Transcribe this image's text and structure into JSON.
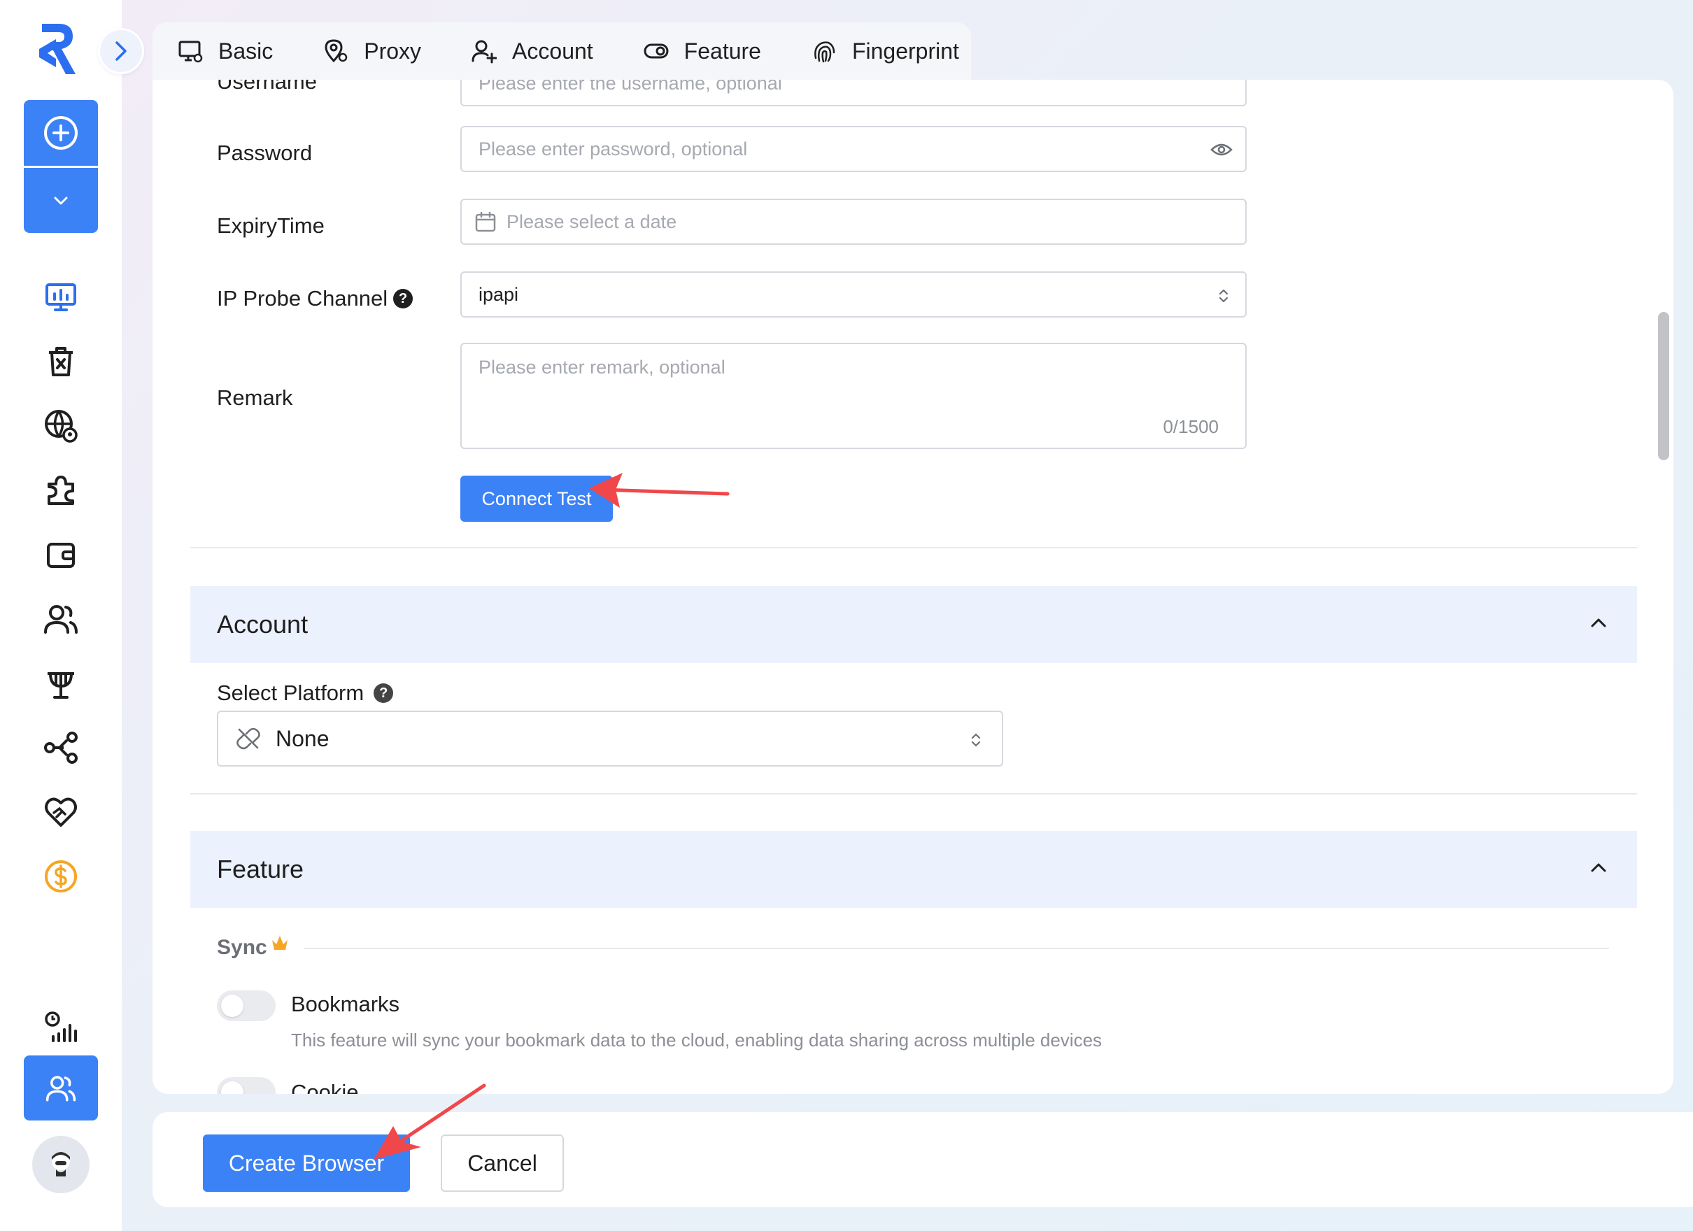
{
  "tabs": [
    {
      "label": "Basic",
      "icon": "monitor-settings-icon"
    },
    {
      "label": "Proxy",
      "icon": "location-settings-icon"
    },
    {
      "label": "Account",
      "icon": "user-add-icon"
    },
    {
      "label": "Feature",
      "icon": "toggle-icon"
    },
    {
      "label": "Fingerprint",
      "icon": "fingerprint-icon"
    }
  ],
  "form": {
    "username_label": "Username",
    "username_placeholder": "Please enter the username, optional",
    "password_label": "Password",
    "password_placeholder": "Please enter password, optional",
    "expiry_label": "ExpiryTime",
    "expiry_placeholder": "Please select a date",
    "ip_probe_label": "IP Probe Channel",
    "ip_probe_value": "ipapi",
    "remark_label": "Remark",
    "remark_placeholder": "Please enter remark, optional",
    "remark_count": "0/1500",
    "connect_test_label": "Connect Test"
  },
  "account_section": {
    "title": "Account",
    "select_platform_label": "Select Platform",
    "platform_value": "None"
  },
  "feature_section": {
    "title": "Feature",
    "sync_label": "Sync",
    "bookmarks_label": "Bookmarks",
    "bookmarks_desc": "This feature will sync your bookmark data to the cloud, enabling data sharing across multiple devices",
    "cookie_label": "Cookie"
  },
  "footer": {
    "create_label": "Create Browser",
    "cancel_label": "Cancel"
  },
  "colors": {
    "primary": "#3b82f6",
    "section_bg": "#ebf1fd",
    "annotation_arrow": "#f0474a",
    "crown": "#f5a623",
    "dollar": "#f5a623"
  }
}
